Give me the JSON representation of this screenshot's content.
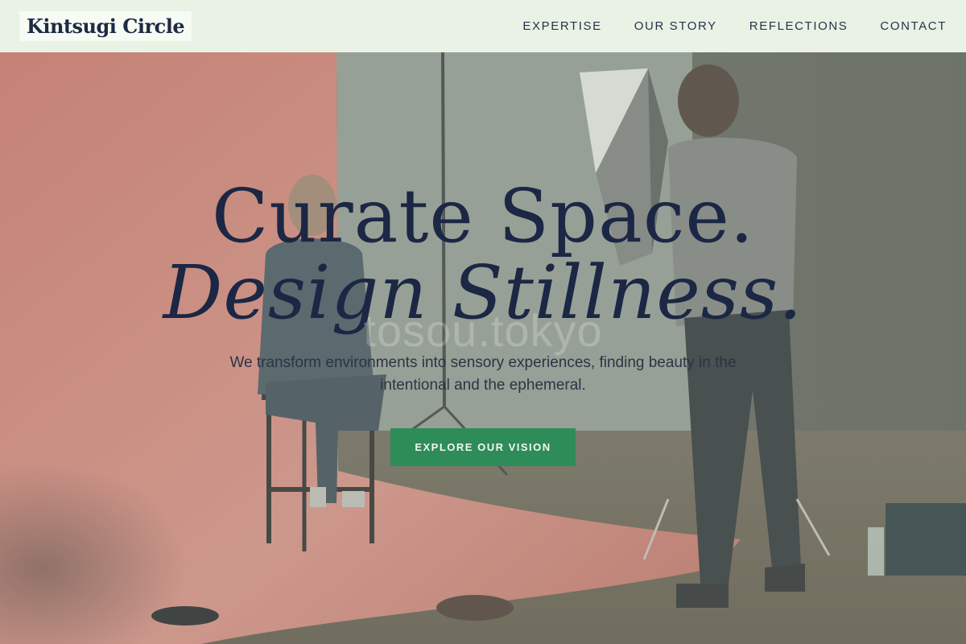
{
  "brand": {
    "name": "Kintsugi Circle"
  },
  "nav": {
    "items": [
      {
        "label": "EXPERTISE"
      },
      {
        "label": "OUR STORY"
      },
      {
        "label": "REFLECTIONS"
      },
      {
        "label": "CONTACT"
      }
    ]
  },
  "hero": {
    "headline_line1": "Curate Space.",
    "headline_line2": "Design Stillness.",
    "watermark": "tosou.tokyo",
    "subtitle": "We transform environments into sensory experiences, finding beauty in the intentional and the ephemeral.",
    "cta_label": "EXPLORE OUR VISION"
  },
  "colors": {
    "header_bg": "#e9f2e5",
    "brand_text": "#1d2a44",
    "headline": "#1b2744",
    "cta_bg": "#2d8c57",
    "backdrop_red": "#c8766a"
  }
}
